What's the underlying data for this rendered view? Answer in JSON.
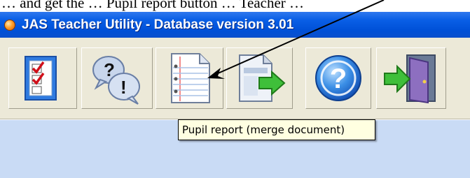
{
  "caption_text": "… and get the … Pupil report button … Teacher …",
  "window": {
    "title": "JAS Teacher Utility - Database version 3.01"
  },
  "toolbar": {
    "buttons": [
      {
        "icon": "checklist-icon"
      },
      {
        "icon": "question-exclamation-icon"
      },
      {
        "icon": "notepad-document-icon"
      },
      {
        "icon": "export-document-arrow-icon"
      },
      {
        "icon": "help-icon",
        "glyph": "?"
      },
      {
        "icon": "exit-door-icon"
      }
    ]
  },
  "tooltip": {
    "text": "Pupil report (merge document)"
  },
  "colors": {
    "titlebar": "#0051d8",
    "toolbar_bg": "#ece9d8",
    "content_bg": "#c9dbf5",
    "tooltip_bg": "#ffffe1"
  }
}
